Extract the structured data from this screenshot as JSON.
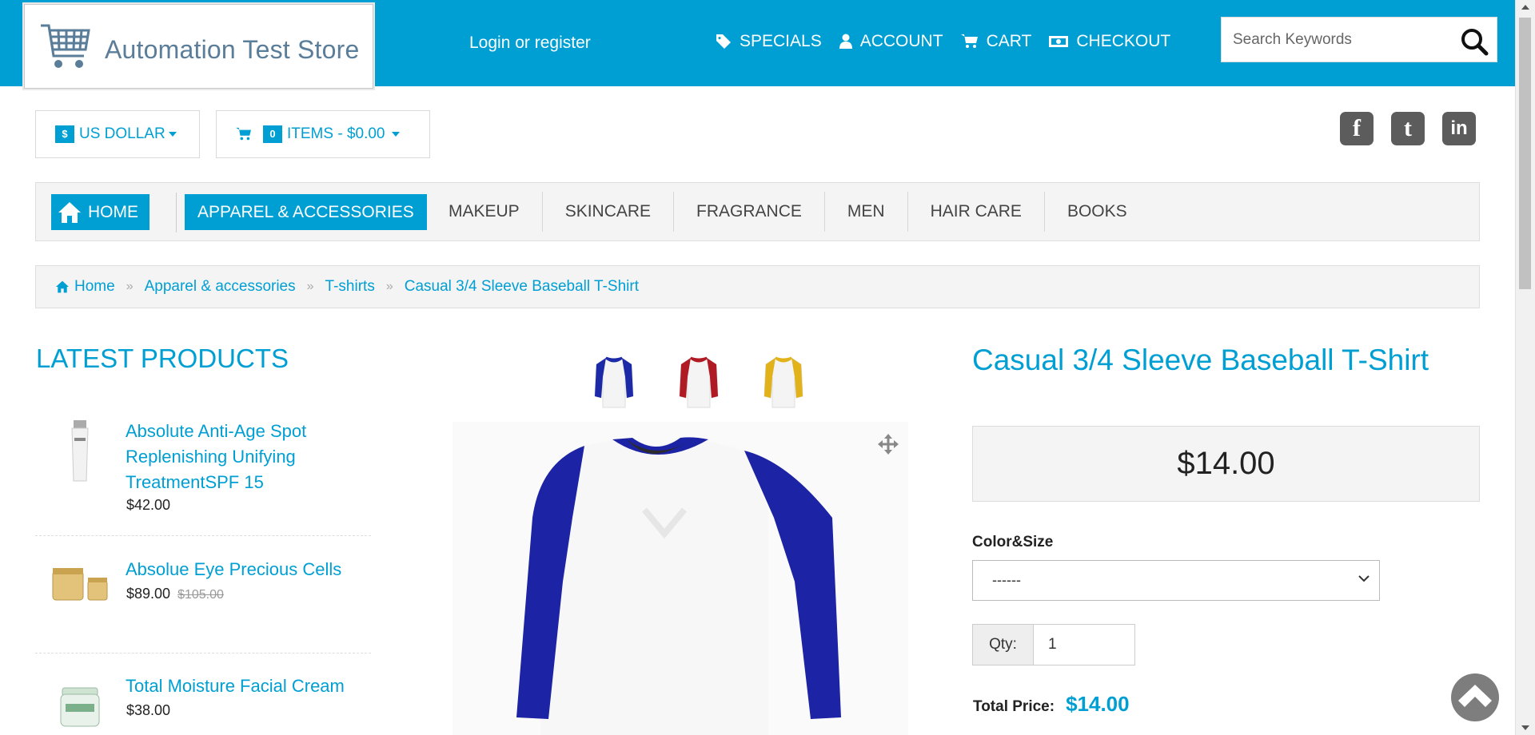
{
  "brand": {
    "name": "Automation Test Store",
    "accent": "#009fd3"
  },
  "header": {
    "login_label": "Login or register",
    "nav": [
      {
        "label": "SPECIALS",
        "icon": "tag-icon"
      },
      {
        "label": "ACCOUNT",
        "icon": "user-icon"
      },
      {
        "label": "CART",
        "icon": "cart-icon"
      },
      {
        "label": "CHECKOUT",
        "icon": "money-icon"
      }
    ],
    "search_placeholder": "Search Keywords"
  },
  "currency": {
    "symbol": "$",
    "label": "US DOLLAR"
  },
  "mini_cart": {
    "count": "0",
    "label": "ITEMS - $0.00"
  },
  "social": [
    {
      "label": "f",
      "icon": "facebook-icon"
    },
    {
      "label": "t",
      "icon": "twitter-icon"
    },
    {
      "label": "in",
      "icon": "linkedin-icon"
    }
  ],
  "categories": {
    "home": "HOME",
    "active": "APPAREL & ACCESSORIES",
    "items": [
      "MAKEUP",
      "SKINCARE",
      "FRAGRANCE",
      "MEN",
      "HAIR CARE",
      "BOOKS"
    ]
  },
  "breadcrumb": [
    "Home",
    "Apparel & accessories",
    "T-shirts",
    "Casual 3/4 Sleeve Baseball T-Shirt"
  ],
  "latest": {
    "title": "LATEST PRODUCTS",
    "products": [
      {
        "name": "Absolute Anti-Age Spot Replenishing Unifying TreatmentSPF 15",
        "price": "$42.00",
        "old_price": ""
      },
      {
        "name": "Absolue Eye Precious Cells",
        "price": "$89.00",
        "old_price": "$105.00"
      },
      {
        "name": "Total Moisture Facial Cream",
        "price": "$38.00",
        "old_price": ""
      }
    ]
  },
  "product": {
    "title": "Casual 3/4 Sleeve Baseball T-Shirt",
    "price": "$14.00",
    "option_label": "Color&Size",
    "option_value": "------",
    "qty_label": "Qty:",
    "qty_value": "1",
    "total_label": "Total Price:",
    "total_value": "$14.00",
    "thumb_colors": [
      "#1c2aa8",
      "#b01a24",
      "#e2b21a"
    ]
  }
}
